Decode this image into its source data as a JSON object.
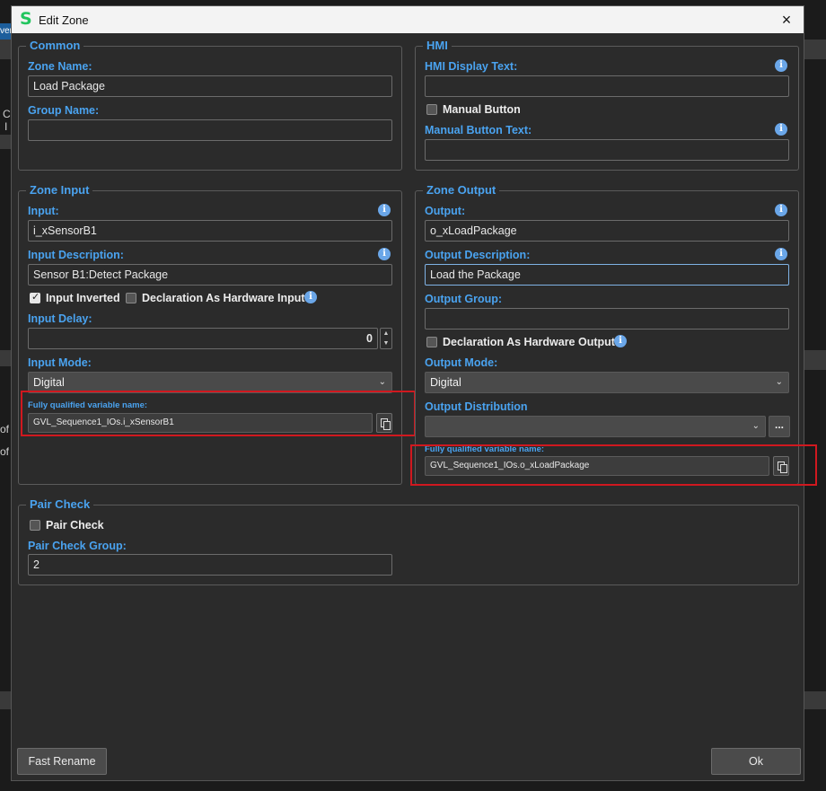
{
  "background": {
    "tab_fragment": "ver",
    "row_fragment_1": "C",
    "row_fragment_2": "I",
    "row_fragment_3": "of",
    "row_fragment_4": "of"
  },
  "dialog": {
    "title": "Edit Zone",
    "logo": "S",
    "close_icon": "×"
  },
  "common": {
    "legend": "Common",
    "zone_name_label": "Zone Name:",
    "zone_name_value": "Load Package",
    "group_name_label": "Group Name:",
    "group_name_value": ""
  },
  "hmi": {
    "legend": "HMI",
    "display_text_label": "HMI Display Text:",
    "display_text_value": "",
    "manual_button_label": "Manual Button",
    "manual_button_checked": false,
    "manual_button_text_label": "Manual Button Text:",
    "manual_button_text_value": ""
  },
  "zone_input": {
    "legend": "Zone Input",
    "input_label": "Input:",
    "input_value": "i_xSensorB1",
    "description_label": "Input Description:",
    "description_value": "Sensor B1:Detect Package",
    "inverted_label": "Input Inverted",
    "inverted_checked": true,
    "hw_input_label": "Declaration As Hardware Input",
    "hw_input_checked": false,
    "delay_label": "Input Delay:",
    "delay_value": "0",
    "mode_label": "Input Mode:",
    "mode_value": "Digital",
    "fq_label": "Fully qualified variable name:",
    "fq_value": "GVL_Sequence1_IOs.i_xSensorB1"
  },
  "zone_output": {
    "legend": "Zone Output",
    "output_label": "Output:",
    "output_value": "o_xLoadPackage",
    "description_label": "Output Description:",
    "description_value": "Load the Package",
    "group_label": "Output Group:",
    "group_value": "",
    "hw_output_label": "Declaration As Hardware Output",
    "hw_output_checked": false,
    "mode_label": "Output Mode:",
    "mode_value": "Digital",
    "distribution_label": "Output Distribution",
    "distribution_value": "",
    "dots_label": "...",
    "fq_label": "Fully qualified variable name:",
    "fq_value": "GVL_Sequence1_IOs.o_xLoadPackage"
  },
  "pair_check": {
    "legend": "Pair Check",
    "checkbox_label": "Pair Check",
    "checked": false,
    "group_label": "Pair Check Group:",
    "group_value": "2"
  },
  "footer": {
    "fast_rename_label": "Fast Rename",
    "ok_label": "Ok"
  },
  "icons": {
    "info": "i",
    "chevron": "⌄",
    "spin_up": "▲",
    "spin_down": "▼"
  },
  "colors": {
    "accent_label": "#4aa3f0",
    "highlight_box": "#d0181f",
    "logo": "#22c55e"
  }
}
